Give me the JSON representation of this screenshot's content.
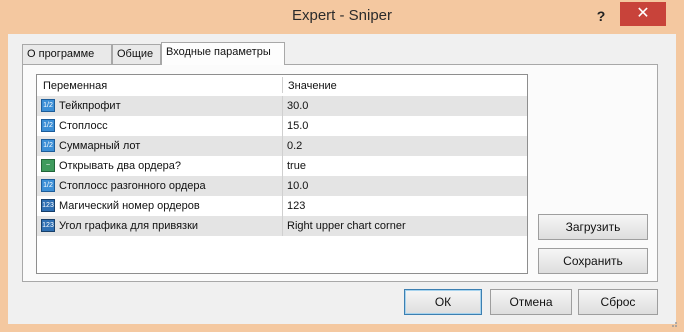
{
  "window": {
    "title": "Expert - Sniper",
    "help_label": "?",
    "close_label": "✕"
  },
  "tabs": [
    {
      "label": "О программе"
    },
    {
      "label": "Общие"
    },
    {
      "label": "Входные параметры",
      "active": true
    }
  ],
  "params": {
    "headers": {
      "variable": "Переменная",
      "value": "Значение"
    },
    "rows": [
      {
        "icon": "numeric-icon",
        "icon_text": "1/2",
        "name": "Тейкпрофит",
        "value": "30.0"
      },
      {
        "icon": "numeric-icon",
        "icon_text": "1/2",
        "name": "Стоплосс",
        "value": "15.0"
      },
      {
        "icon": "numeric-icon",
        "icon_text": "1/2",
        "name": "Суммарный лот",
        "value": "0.2"
      },
      {
        "icon": "boolean-icon",
        "icon_text": "~",
        "name": "Открывать два ордера?",
        "value": "true"
      },
      {
        "icon": "numeric-icon",
        "icon_text": "1/2",
        "name": "Стоплосс разгонного ордера",
        "value": "10.0"
      },
      {
        "icon": "integer-icon",
        "icon_text": "123",
        "name": "Магический номер ордеров",
        "value": "123"
      },
      {
        "icon": "enum-icon",
        "icon_text": "123",
        "name": "Угол графика для привязки",
        "value": "Right upper chart corner"
      }
    ]
  },
  "side_buttons": {
    "load": "Загрузить",
    "save": "Сохранить"
  },
  "footer": {
    "ok": "ОК",
    "cancel": "Отмена",
    "reset": "Сброс"
  },
  "colors": {
    "titlebar": "#f4c8a0",
    "close_button": "#c8433a",
    "row_alt": "#e4e4e4"
  }
}
